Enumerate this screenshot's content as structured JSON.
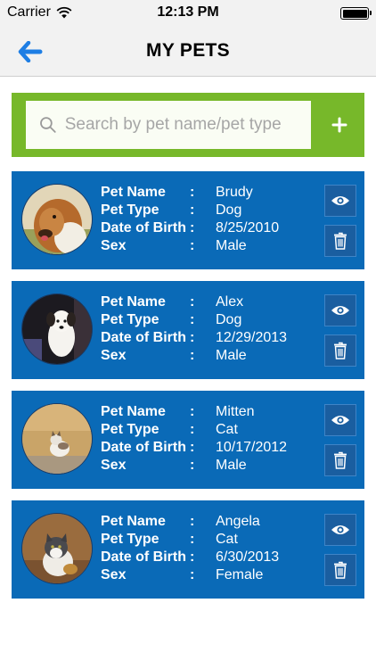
{
  "status_bar": {
    "carrier": "Carrier",
    "time": "12:13 PM"
  },
  "nav": {
    "title": "MY PETS",
    "back_icon": "arrow-left-icon"
  },
  "search": {
    "placeholder": "Search by pet name/pet type",
    "value": "",
    "add_label": "+"
  },
  "labels": {
    "name": "Pet Name",
    "type": "Pet Type",
    "dob": "Date of Birth",
    "sex": "Sex",
    "colon": ":"
  },
  "pets": [
    {
      "name": "Brudy",
      "type": "Dog",
      "dob": "8/25/2010",
      "sex": "Male"
    },
    {
      "name": "Alex",
      "type": "Dog",
      "dob": "12/29/2013",
      "sex": "Male"
    },
    {
      "name": "Mitten",
      "type": "Cat",
      "dob": "10/17/2012",
      "sex": "Male"
    },
    {
      "name": "Angela",
      "type": "Cat",
      "dob": "6/30/2013",
      "sex": "Female"
    }
  ],
  "colors": {
    "accent_green": "#77b82a",
    "card_blue": "#0a6ab7",
    "back_arrow": "#1e7ee4"
  }
}
